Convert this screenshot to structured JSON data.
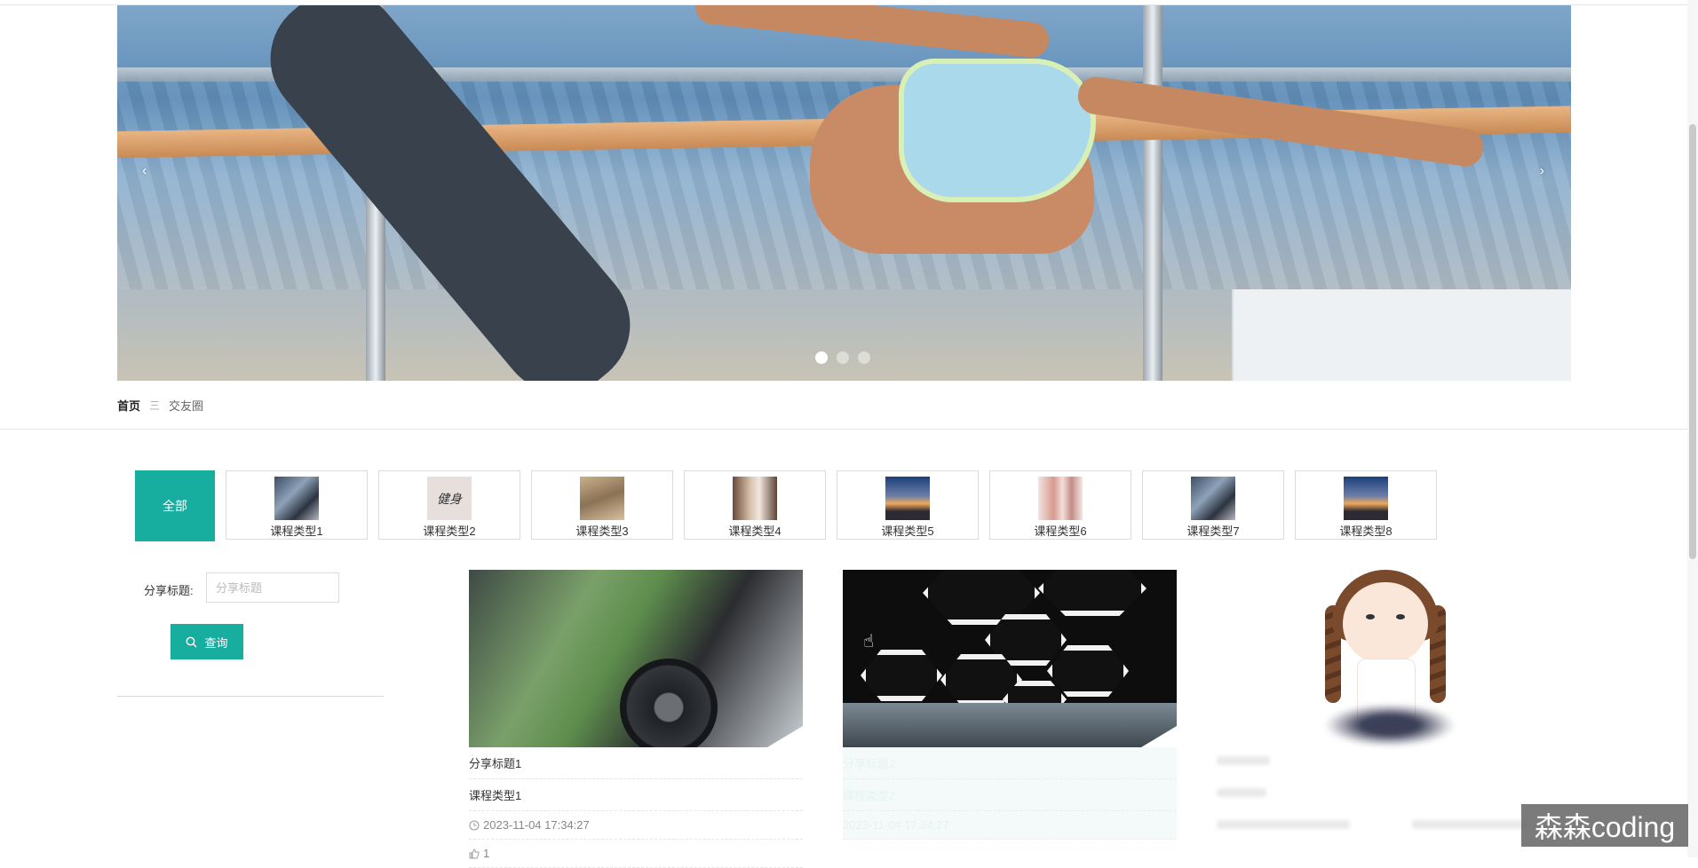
{
  "breadcrumb": {
    "home": "首页",
    "separator": "三",
    "current": "交友圈"
  },
  "banner": {
    "prev_icon": "‹",
    "next_icon": "›",
    "slide_count": 3,
    "active_slide": 1
  },
  "filter": {
    "all_label": "全部",
    "categories": [
      {
        "label": "课程类型1"
      },
      {
        "label": "课程类型2"
      },
      {
        "label": "课程类型3"
      },
      {
        "label": "课程类型4"
      },
      {
        "label": "课程类型5"
      },
      {
        "label": "课程类型6"
      },
      {
        "label": "课程类型7"
      },
      {
        "label": "课程类型8"
      }
    ]
  },
  "search": {
    "label": "分享标题:",
    "placeholder": "分享标题",
    "button_label": "查询"
  },
  "cards": [
    {
      "title": "分享标题1",
      "type": "课程类型1",
      "time": "2023-11-04 17:34:27",
      "likes": "1"
    },
    {
      "title": "分享标题2",
      "type": "课程类型2",
      "time": "2023-11-04 17:34:27"
    }
  ],
  "watermark": "森森coding",
  "colors": {
    "accent": "#17ad9f"
  }
}
